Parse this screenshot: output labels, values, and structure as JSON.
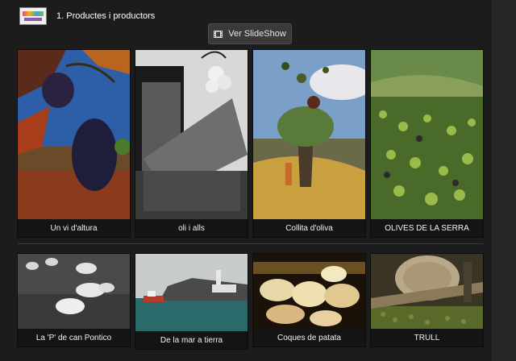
{
  "header": {
    "logo_icon": "brand-logo-icon",
    "title": "1. Productes i productors"
  },
  "slideshow": {
    "label": "Ver SlideShow",
    "icon": "film-icon"
  },
  "gallery": {
    "items": [
      {
        "caption": "Un vi d'altura"
      },
      {
        "caption": "oli i alls"
      },
      {
        "caption": "Collita d'oliva"
      },
      {
        "caption": "OLIVES DE LA SERRA"
      },
      {
        "caption": "La 'P' de can Pontico"
      },
      {
        "caption": "De la mar a tierra"
      },
      {
        "caption": "Coques de patata"
      },
      {
        "caption": "TRULL"
      }
    ]
  }
}
